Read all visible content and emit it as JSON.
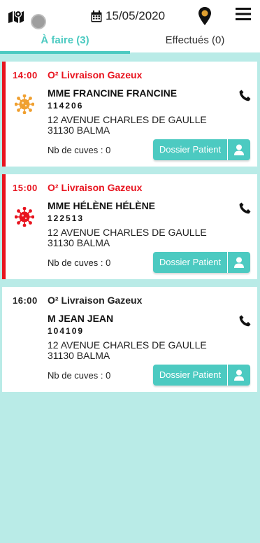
{
  "header": {
    "date": "15/05/2020",
    "icons": {
      "map": "map-marker-icon",
      "calendar": "calendar-icon",
      "location": "location-pin-icon",
      "menu": "hamburger-menu-icon"
    },
    "colors": {
      "accent": "#4ccac1",
      "pin": "#e0a030",
      "urgent": "#e8141f",
      "background": "#b9ebe7"
    }
  },
  "tabs": [
    {
      "label": "À faire (3)",
      "active": true
    },
    {
      "label": "Effectués (0)",
      "active": false
    }
  ],
  "deliveries": [
    {
      "time": "14:00",
      "title": "O² Livraison Gazeux",
      "urgent": true,
      "virus_icon": "virus-orange-icon",
      "name": "MME FRANCINE FRANCINE",
      "code": "114206",
      "address_line1": "12 AVENUE CHARLES DE GAULLE",
      "address_line2": "31130 BALMA",
      "cuves": "Nb de cuves : 0",
      "dossier_label": "Dossier Patient"
    },
    {
      "time": "15:00",
      "title": "O² Livraison Gazeux",
      "urgent": true,
      "virus_icon": "virus-red-icon",
      "name": "MME HÉLÈNE HÉLÈNE",
      "code": "122513",
      "address_line1": "12 AVENUE CHARLES DE GAULLE",
      "address_line2": "31130 BALMA",
      "cuves": "Nb de cuves : 0",
      "dossier_label": "Dossier Patient"
    },
    {
      "time": "16:00",
      "title": "O² Livraison Gazeux",
      "urgent": false,
      "virus_icon": "",
      "name": "M JEAN JEAN",
      "code": "104109",
      "address_line1": "12 AVENUE CHARLES DE GAULLE",
      "address_line2": "31130 BALMA",
      "cuves": "Nb de cuves : 0",
      "dossier_label": "Dossier Patient"
    }
  ]
}
